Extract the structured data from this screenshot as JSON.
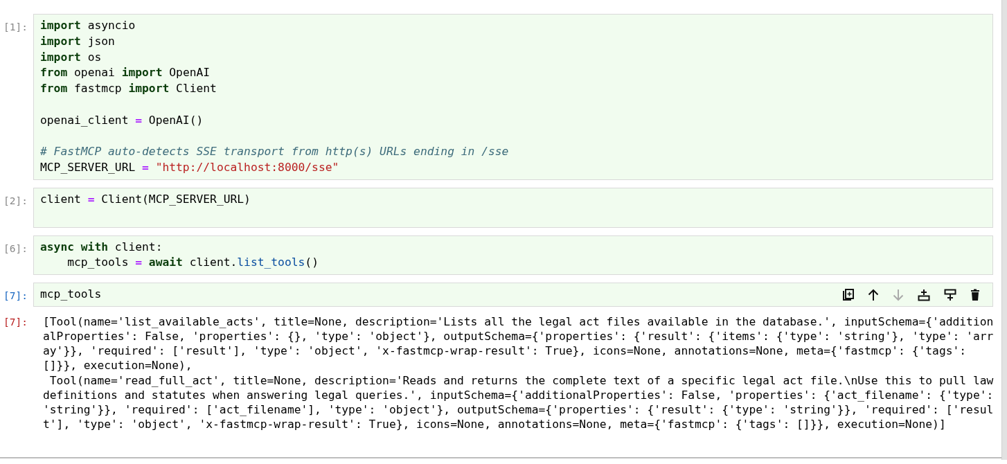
{
  "cells": [
    {
      "prompt": "[1]:",
      "selected": false,
      "trailing_blank_line": false,
      "lines": [
        {
          "blank_before": false,
          "tokens": [
            {
              "kind": "kw",
              "text": "import"
            },
            {
              "kind": "plain",
              "text": " asyncio"
            }
          ]
        },
        {
          "blank_before": false,
          "tokens": [
            {
              "kind": "kw",
              "text": "import"
            },
            {
              "kind": "plain",
              "text": " json"
            }
          ]
        },
        {
          "blank_before": false,
          "tokens": [
            {
              "kind": "kw",
              "text": "import"
            },
            {
              "kind": "plain",
              "text": " os"
            }
          ]
        },
        {
          "blank_before": false,
          "tokens": [
            {
              "kind": "kw",
              "text": "from"
            },
            {
              "kind": "plain",
              "text": " openai "
            },
            {
              "kind": "kw",
              "text": "import"
            },
            {
              "kind": "plain",
              "text": " OpenAI"
            }
          ]
        },
        {
          "blank_before": false,
          "tokens": [
            {
              "kind": "kw",
              "text": "from"
            },
            {
              "kind": "plain",
              "text": " fastmcp "
            },
            {
              "kind": "kw",
              "text": "import"
            },
            {
              "kind": "plain",
              "text": " Client"
            }
          ]
        },
        {
          "blank_before": true,
          "tokens": [
            {
              "kind": "plain",
              "text": "openai_client "
            },
            {
              "kind": "op",
              "text": "="
            },
            {
              "kind": "plain",
              "text": " OpenAI()"
            }
          ]
        },
        {
          "blank_before": true,
          "tokens": [
            {
              "kind": "comment",
              "text": "# FastMCP auto-detects SSE transport from http(s) URLs ending in /sse"
            }
          ]
        },
        {
          "blank_before": false,
          "tokens": [
            {
              "kind": "plain",
              "text": "MCP_SERVER_URL "
            },
            {
              "kind": "op",
              "text": "="
            },
            {
              "kind": "str",
              "text": " \"http://localhost:8000/sse\""
            }
          ]
        }
      ]
    },
    {
      "prompt": "[2]:",
      "selected": false,
      "trailing_blank_line": true,
      "lines": [
        {
          "blank_before": false,
          "tokens": [
            {
              "kind": "plain",
              "text": "client "
            },
            {
              "kind": "op",
              "text": "="
            },
            {
              "kind": "plain",
              "text": " Client(MCP_SERVER_URL)"
            }
          ]
        }
      ]
    },
    {
      "prompt": "[6]:",
      "selected": false,
      "trailing_blank_line": false,
      "lines": [
        {
          "blank_before": false,
          "tokens": [
            {
              "kind": "kw",
              "text": "async"
            },
            {
              "kind": "kw",
              "text": " with"
            },
            {
              "kind": "plain",
              "text": " client:"
            }
          ]
        },
        {
          "blank_before": false,
          "tokens": [
            {
              "kind": "plain",
              "text": "    mcp_tools "
            },
            {
              "kind": "op",
              "text": "="
            },
            {
              "kind": "kw",
              "text": " await"
            },
            {
              "kind": "plain",
              "text": " client."
            },
            {
              "kind": "attr",
              "text": "list_tools"
            },
            {
              "kind": "plain",
              "text": "()"
            }
          ]
        }
      ]
    },
    {
      "prompt": "[7]:",
      "selected": true,
      "trailing_blank_line": false,
      "lines": [
        {
          "blank_before": false,
          "tokens": [
            {
              "kind": "plain",
              "text": "mcp_tools"
            }
          ]
        }
      ],
      "toolbar": [
        {
          "kind": "duplicate",
          "disabled": false
        },
        {
          "kind": "move-up",
          "disabled": false
        },
        {
          "kind": "move-down",
          "disabled": true
        },
        {
          "kind": "insert-above",
          "disabled": false
        },
        {
          "kind": "insert-below",
          "disabled": false
        },
        {
          "kind": "delete",
          "disabled": false
        }
      ],
      "output": {
        "prompt": "[7]:",
        "lines": [
          "[Tool(name='list_available_acts', title=None, description='Lists all the legal act files available in the database.', inputSchema={'addition",
          "alProperties': False, 'properties': {}, 'type': 'object'}, outputSchema={'properties': {'result': {'items': {'type': 'string'}, 'type': 'arr",
          "ay'}}, 'required': ['result'], 'type': 'object', 'x-fastmcp-wrap-result': True}, icons=None, annotations=None, meta={'fastmcp': {'tags':",
          "[]}}, execution=None),",
          " Tool(name='read_full_act', title=None, description='Reads and returns the complete text of a specific legal act file.\\nUse this to pull law",
          "definitions and statutes when answering legal queries.', inputSchema={'additionalProperties': False, 'properties': {'act_filename': {'type':",
          "'string'}}, 'required': ['act_filename'], 'type': 'object'}, outputSchema={'properties': {'result': {'type': 'string'}}, 'required': ['resul",
          "t'], 'type': 'object', 'x-fastmcp-wrap-result': True}, icons=None, annotations=None, meta={'fastmcp': {'tags': []}}, execution=None)]"
        ]
      }
    }
  ]
}
